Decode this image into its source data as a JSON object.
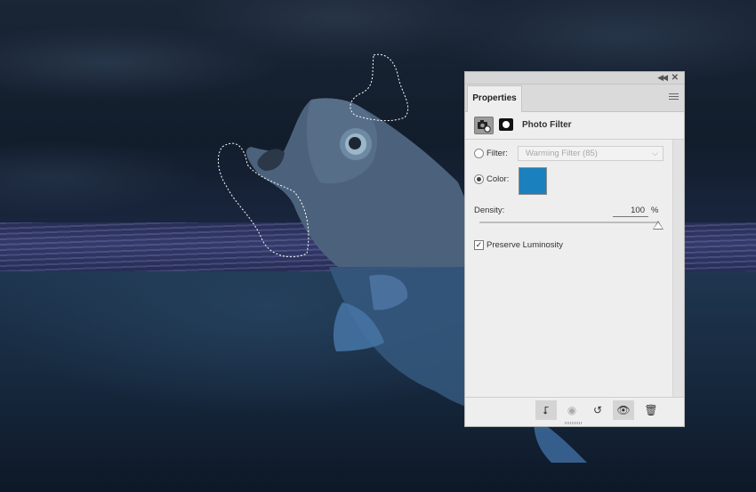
{
  "panel": {
    "tab_label": "Properties",
    "adjustment_title": "Photo Filter",
    "filter_label": "Filter:",
    "filter_value": "Warming Filter (85)",
    "color_label": "Color:",
    "color_value": "#1a80be",
    "color_selected": true,
    "density_label": "Density:",
    "density_value": "100",
    "density_unit": "%",
    "preserve_luminosity_label": "Preserve Luminosity",
    "preserve_luminosity_checked": true
  },
  "footer_icons": [
    "clip-to-layer-icon",
    "view-previous-icon",
    "reset-icon",
    "visibility-eye-icon",
    "trash-icon"
  ],
  "icons": {
    "adjustment": "photo-filter-adjustment-icon",
    "mask": "layer-mask-icon",
    "menu": "panel-menu-icon",
    "collapse": "collapse-panel-icon",
    "close": "close-panel-icon"
  }
}
